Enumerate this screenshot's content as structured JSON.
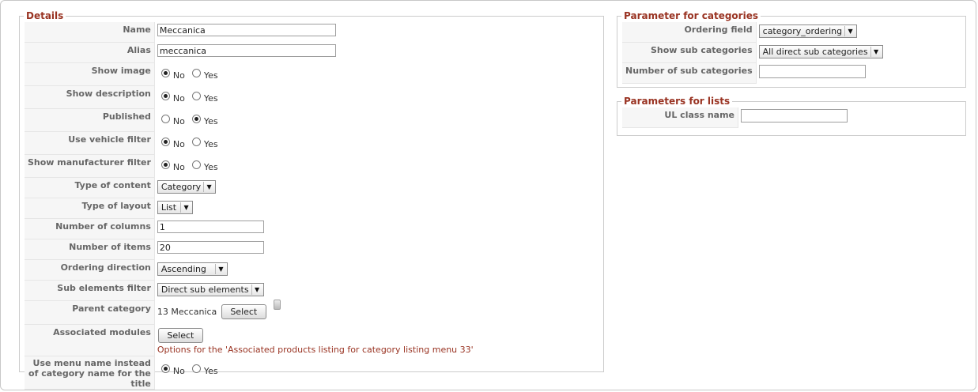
{
  "details": {
    "legend": "Details",
    "name": {
      "label": "Name",
      "value": "Meccanica"
    },
    "alias": {
      "label": "Alias",
      "value": "meccanica"
    },
    "show_image": {
      "label": "Show image",
      "no": "No",
      "yes": "Yes",
      "selected": "No"
    },
    "show_description": {
      "label": "Show description",
      "no": "No",
      "yes": "Yes",
      "selected": "No"
    },
    "published": {
      "label": "Published",
      "no": "No",
      "yes": "Yes",
      "selected": "Yes"
    },
    "use_vehicle_filter": {
      "label": "Use vehicle filter",
      "no": "No",
      "yes": "Yes",
      "selected": "No"
    },
    "show_manufacturer_filter": {
      "label": "Show manufacturer filter",
      "no": "No",
      "yes": "Yes",
      "selected": "No"
    },
    "type_of_content": {
      "label": "Type of content",
      "value": "Category"
    },
    "type_of_layout": {
      "label": "Type of layout",
      "value": "List"
    },
    "number_of_columns": {
      "label": "Number of columns",
      "value": "1"
    },
    "number_of_items": {
      "label": "Number of items",
      "value": "20"
    },
    "ordering_direction": {
      "label": "Ordering direction",
      "value": "Ascending"
    },
    "sub_elements_filter": {
      "label": "Sub elements filter",
      "value": "Direct sub elements"
    },
    "parent_category": {
      "label": "Parent category",
      "value": "13 Meccanica",
      "button": "Select"
    },
    "associated_modules": {
      "label": "Associated modules",
      "button": "Select",
      "note": "Options for the 'Associated products listing for category listing menu 33'"
    },
    "use_menu_name": {
      "label": "Use menu name instead of category name for the title",
      "no": "No",
      "yes": "Yes",
      "selected": "No"
    }
  },
  "categories": {
    "legend": "Parameter for categories",
    "ordering_field": {
      "label": "Ordering field",
      "value": "category_ordering"
    },
    "show_sub_categories": {
      "label": "Show sub categories",
      "value": "All direct sub categories"
    },
    "number_of_sub_categories": {
      "label": "Number of sub categories",
      "value": ""
    }
  },
  "lists": {
    "legend": "Parameters for lists",
    "ul_class_name": {
      "label": "UL class name",
      "value": ""
    }
  }
}
